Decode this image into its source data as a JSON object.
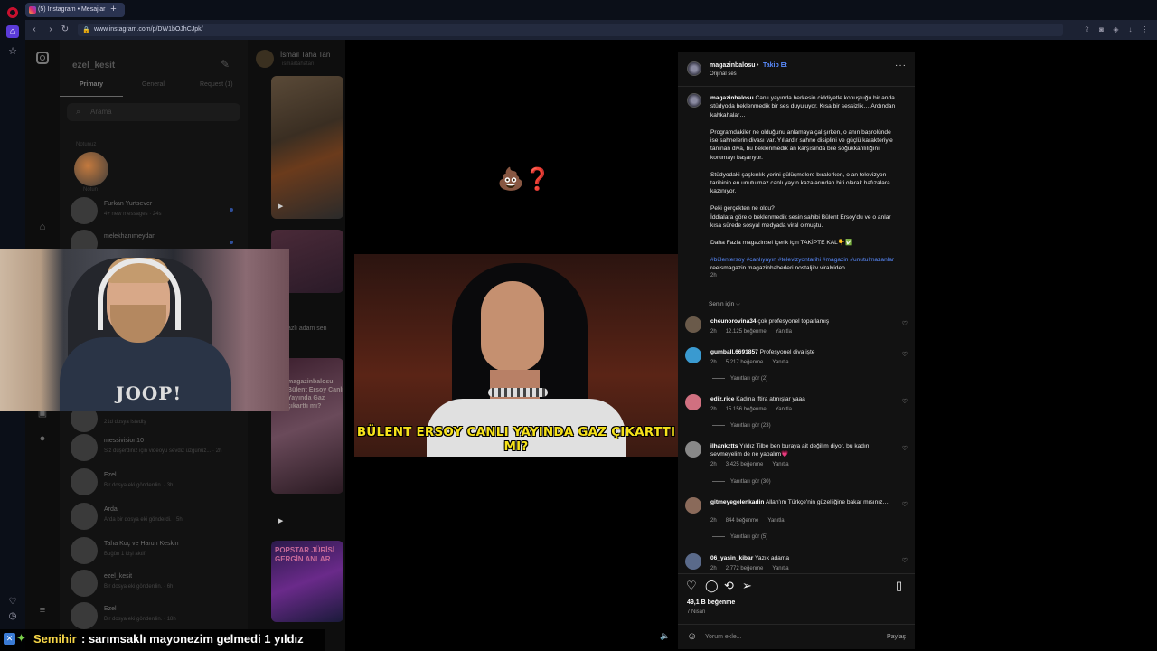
{
  "browser": {
    "tab_title": "(5) Instagram • Mesajlar",
    "new_tab_icon": "plus-icon",
    "url": "www.instagram.com/p/DW1bOJhCJpk/"
  },
  "dm": {
    "username": "ezel_kesit",
    "tabs": [
      "Primary",
      "General",
      "Request (1)"
    ],
    "search_placeholder": "Arama",
    "note_label": "Notunuz",
    "note_name": "Notun",
    "rows": [
      {
        "name": "Furkan Yurtsever",
        "sub": "4+ new messages · 24s"
      },
      {
        "name": "melekhanımeydan",
        "sub": ""
      },
      {
        "name": "",
        "sub": "21d dosya istediş"
      },
      {
        "name": "messivision10",
        "sub": "Siz düşerdiniz için videoyu sevdiz üzgünüz... · 2h"
      },
      {
        "name": "Ezel",
        "sub": "Bir dosya eki gönderdin. · 3h"
      },
      {
        "name": "Arda",
        "sub": "Arda bir dosya eki gönderdi. · 5h"
      },
      {
        "name": "Taha Koç ve Harun Keskin",
        "sub": "Buğün 1 kişi aktif"
      },
      {
        "name": "ezel_kesit",
        "sub": "Bir dosya eki gönderdin. · 6h"
      },
      {
        "name": "Ezel",
        "sub": "Bir dosya eki gönderdin. · 18h"
      }
    ]
  },
  "thread": {
    "name": "İsmail Taha Tan",
    "handle": "ismailtahatan",
    "caption1": "azlı adam sen",
    "overlay1": "magazinbalosu Bülent Ersoy Canlı Yayında Gaz çıkarttı mı?",
    "overlay2": "POPSTAR JÜRİSİ GERGİN ANLAR"
  },
  "post": {
    "username": "magazinbalosu",
    "dot": "•",
    "follow": "Takip Et",
    "audio": "Orijinal ses",
    "emoji_overlay": "💩❓",
    "video_caption": "BÜLENT ERSOY CANLI YAYINDA GAZ ÇIKARTTI MI?",
    "caption": {
      "user": "magazinbalosu",
      "p1": "Canlı yayında herkesin ciddiyetle konuştuğu bir anda stüdyoda beklenmedik bir ses duyuluyor. Kısa bir sessizlik… Ardından kahkahalar…",
      "p2": "Programdakiler ne olduğunu anlamaya çalışırken, o anın başrolünde ise sahnelerin divası var. Yıllardır sahne disiplini ve güçlü karakteriyle tanınan diva, bu beklenmedik an karşısında bile soğukkanlılığını korumayı başarıyor.",
      "p3": "Stüdyodaki şaşkınlık yerini gülüşmelere bırakırken, o an televizyon tarihinin en unutulmaz canlı yayın kazalarından biri olarak hafızalara kazınıyor.",
      "p4a": "Peki gerçekten ne oldu?",
      "p4b": "İddialara göre o beklenmedik sesin sahibi Bülent Ersoy'du ve o anlar kısa sürede sosyal medyada viral olmuştu.",
      "p5": "Daha Fazla magazinsel içerik için TAKİPTE KAL👇✅",
      "tags": "#bülentersoy #canlıyayın #televizyontarihi #magazin #unutulmazanlar",
      "plain_tags": "reelsmagazin magazinhaberleri nostaljitv viralvideo",
      "time": "2h"
    },
    "for_you": "Senin için ⌵",
    "comments": [
      {
        "user": "cheunorovina34",
        "text": "çok profesyonel toparlamış",
        "time": "2h",
        "likes": "12.125 beğenme",
        "reply": "Yanıtla",
        "replies": "",
        "color": "#6a5a4a"
      },
      {
        "user": "gumball.6691857",
        "text": "Profesyonel diva işte",
        "time": "2h",
        "likes": "5.217 beğenme",
        "reply": "Yanıtla",
        "replies": "Yanıtları gör (2)",
        "color": "#3a9ad0"
      },
      {
        "user": "ediz.rice",
        "text": "Kadına iftira atmışlar yaaa",
        "time": "2h",
        "likes": "15.156 beğenme",
        "reply": "Yanıtla",
        "replies": "Yanıtları gör (23)",
        "color": "#d07080"
      },
      {
        "user": "ilhankztts",
        "text": "Yıldız Tilbe ben buraya ait değilim diyor. bu kadını sevmeyelim de ne yapalım💗",
        "time": "2h",
        "likes": "3.425 beğenme",
        "reply": "Yanıtla",
        "replies": "Yanıtları gör (30)",
        "color": "#888888"
      },
      {
        "user": "gitmeyegelenkadin",
        "text": "Allah'ım Türkçe'nin güzelliğine bakar mısınız…",
        "time": "2h",
        "likes": "844 beğenme",
        "reply": "Yanıtla",
        "replies": "Yanıtları gör (5)",
        "color": "#8a6a5a"
      },
      {
        "user": "06_yasin_kibar",
        "text": "Yazık adama",
        "time": "2h",
        "likes": "2.772 beğenme",
        "reply": "Yanıtla",
        "replies": "",
        "color": "#5a6a8a"
      }
    ],
    "likes": "49,1 B beğenme",
    "date": "7 Nisan",
    "comment_placeholder": "Yorum ekle...",
    "post_button": "Paylaş"
  },
  "chat_overlay": {
    "name": "Semihir",
    "message": ": sarımsaklı mayonezim gelmedi 1 yıldız"
  }
}
